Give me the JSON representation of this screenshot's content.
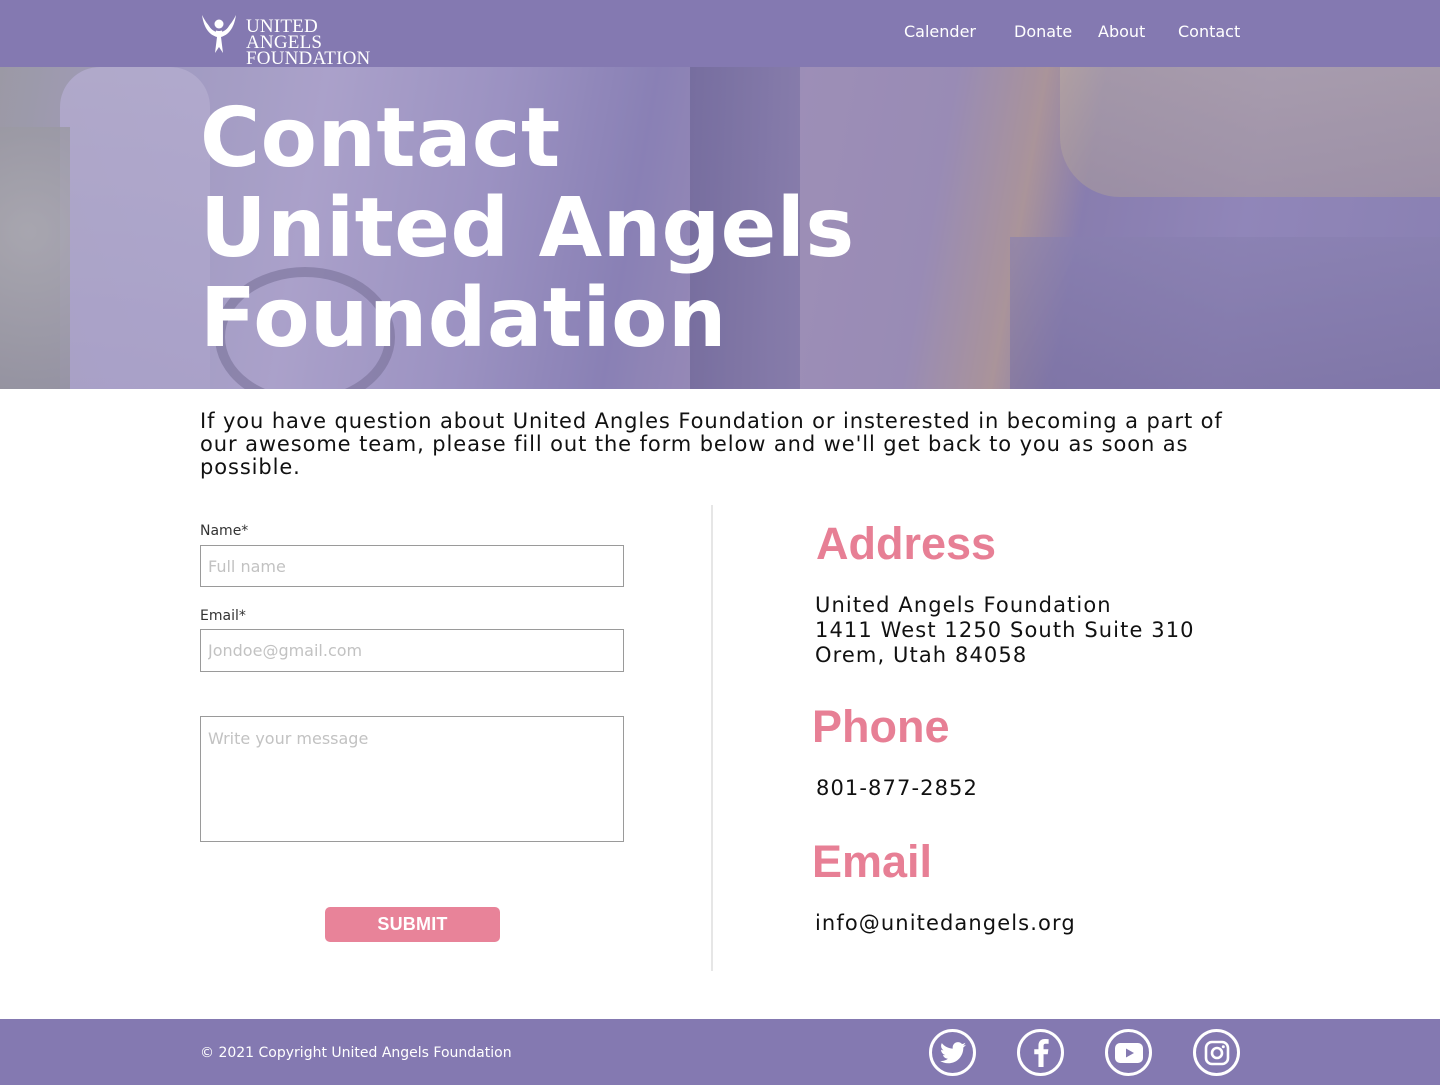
{
  "brand": {
    "logo_line1": "UNITED ANGELS",
    "logo_line2": "FOUNDATION"
  },
  "nav": {
    "items": [
      {
        "label": "Calender"
      },
      {
        "label": "Donate"
      },
      {
        "label": "About"
      },
      {
        "label": "Contact"
      }
    ]
  },
  "hero": {
    "title_lines": [
      "Contact",
      "United Angels",
      "Foundation"
    ]
  },
  "intro": {
    "text": "If you have question about United Angles Foundation or insterested in becoming a part of our awesome team, please fill out the form below and we'll get back to you as soon as possible."
  },
  "form": {
    "name_label": "Name*",
    "name_placeholder": "Full name",
    "name_value": "",
    "email_label": "Email*",
    "email_placeholder": "Jondoe@gmail.com",
    "email_value": "",
    "message_placeholder": "Write your message",
    "message_value": "",
    "submit_label": "SUBMIT"
  },
  "contact": {
    "address_heading": "Address",
    "address_lines": [
      "United Angels Foundation",
      "1411 West 1250 South Suite 310",
      "Orem, Utah 84058"
    ],
    "phone_heading": "Phone",
    "phone": "801-877-2852",
    "email_heading": "Email",
    "email": "info@unitedangels.org"
  },
  "footer": {
    "copyright": "© 2021 Copyright United Angels Foundation",
    "social": [
      "twitter-icon",
      "facebook-icon",
      "youtube-icon",
      "instagram-icon"
    ]
  },
  "colors": {
    "header_bg": "#8479b1",
    "accent_pink": "#e77f95",
    "button_pink": "#e88399"
  }
}
